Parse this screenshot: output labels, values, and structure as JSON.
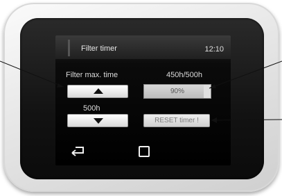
{
  "screen": {
    "title": "Filter timer",
    "clock": "12:10"
  },
  "left_panel": {
    "label": "Filter max. time",
    "value": "500h",
    "up_button_icon": "arrow-up-icon",
    "down_button_icon": "arrow-down-icon"
  },
  "right_panel": {
    "label": "450h/500h",
    "progress_text": "90%",
    "progress_fraction": 0.9,
    "reset_label": "RESET timer !"
  },
  "nav": {
    "back_icon": "back-arrow-icon",
    "home_icon": "home-square-icon"
  },
  "colors": {
    "screen_bg": "#000000",
    "bezel": "#e6e6e6",
    "text": "#dcdcdc"
  }
}
